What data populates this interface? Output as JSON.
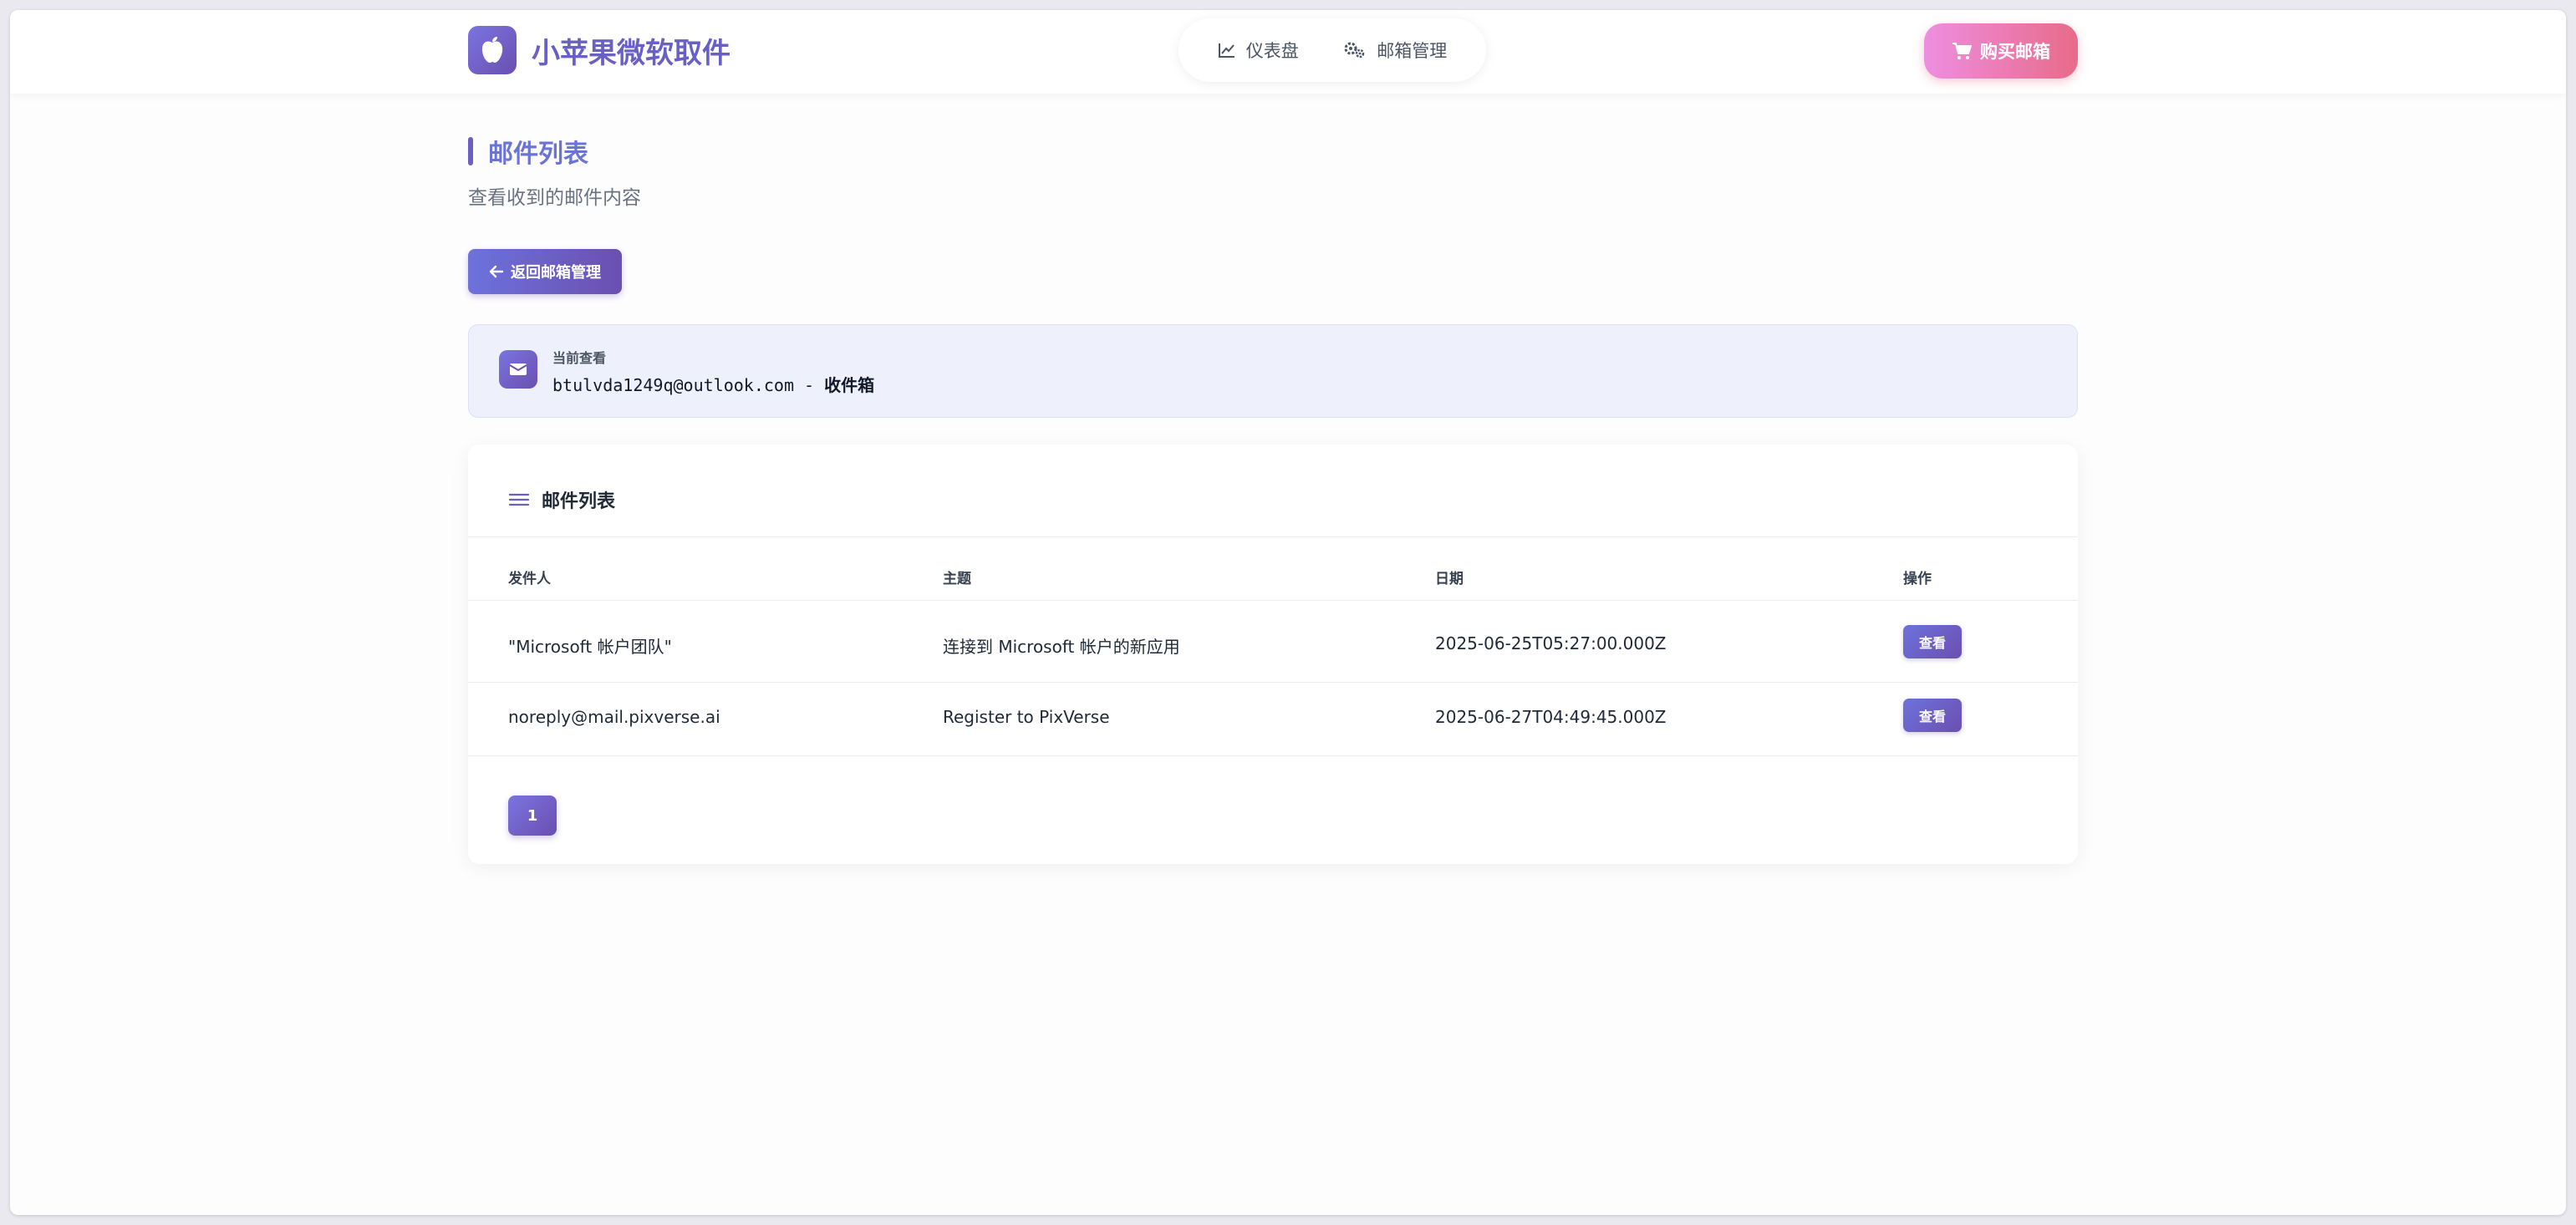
{
  "header": {
    "brand_title": "小苹果微软取件",
    "nav": [
      {
        "label": "仪表盘",
        "icon": "chart-line-icon"
      },
      {
        "label": "邮箱管理",
        "icon": "gears-icon"
      }
    ],
    "buy_label": "购买邮箱"
  },
  "page": {
    "title": "邮件列表",
    "subtitle": "查看收到的邮件内容",
    "back_label": "返回邮箱管理"
  },
  "current": {
    "label": "当前查看",
    "email": "btulvda1249q@outlook.com",
    "separator": " - ",
    "folder": "收件箱"
  },
  "card": {
    "title": "邮件列表",
    "columns": [
      "发件人",
      "主题",
      "日期",
      "操作"
    ],
    "rows": [
      {
        "sender": "\"Microsoft 帐户团队\"",
        "subject": "连接到 Microsoft 帐户的新应用",
        "date": "2025-06-25T05:27:00.000Z",
        "action": "查看"
      },
      {
        "sender": "noreply@mail.pixverse.ai",
        "subject": "Register to PixVerse",
        "date": "2025-06-27T04:49:45.000Z",
        "action": "查看"
      }
    ],
    "pagination": {
      "current_page": "1"
    }
  },
  "colors": {
    "accent": "#6a5fc4",
    "buy_gradient_start": "#ee8ee0",
    "buy_gradient_end": "#e86b8a",
    "current_box_bg": "#eef0fb"
  }
}
